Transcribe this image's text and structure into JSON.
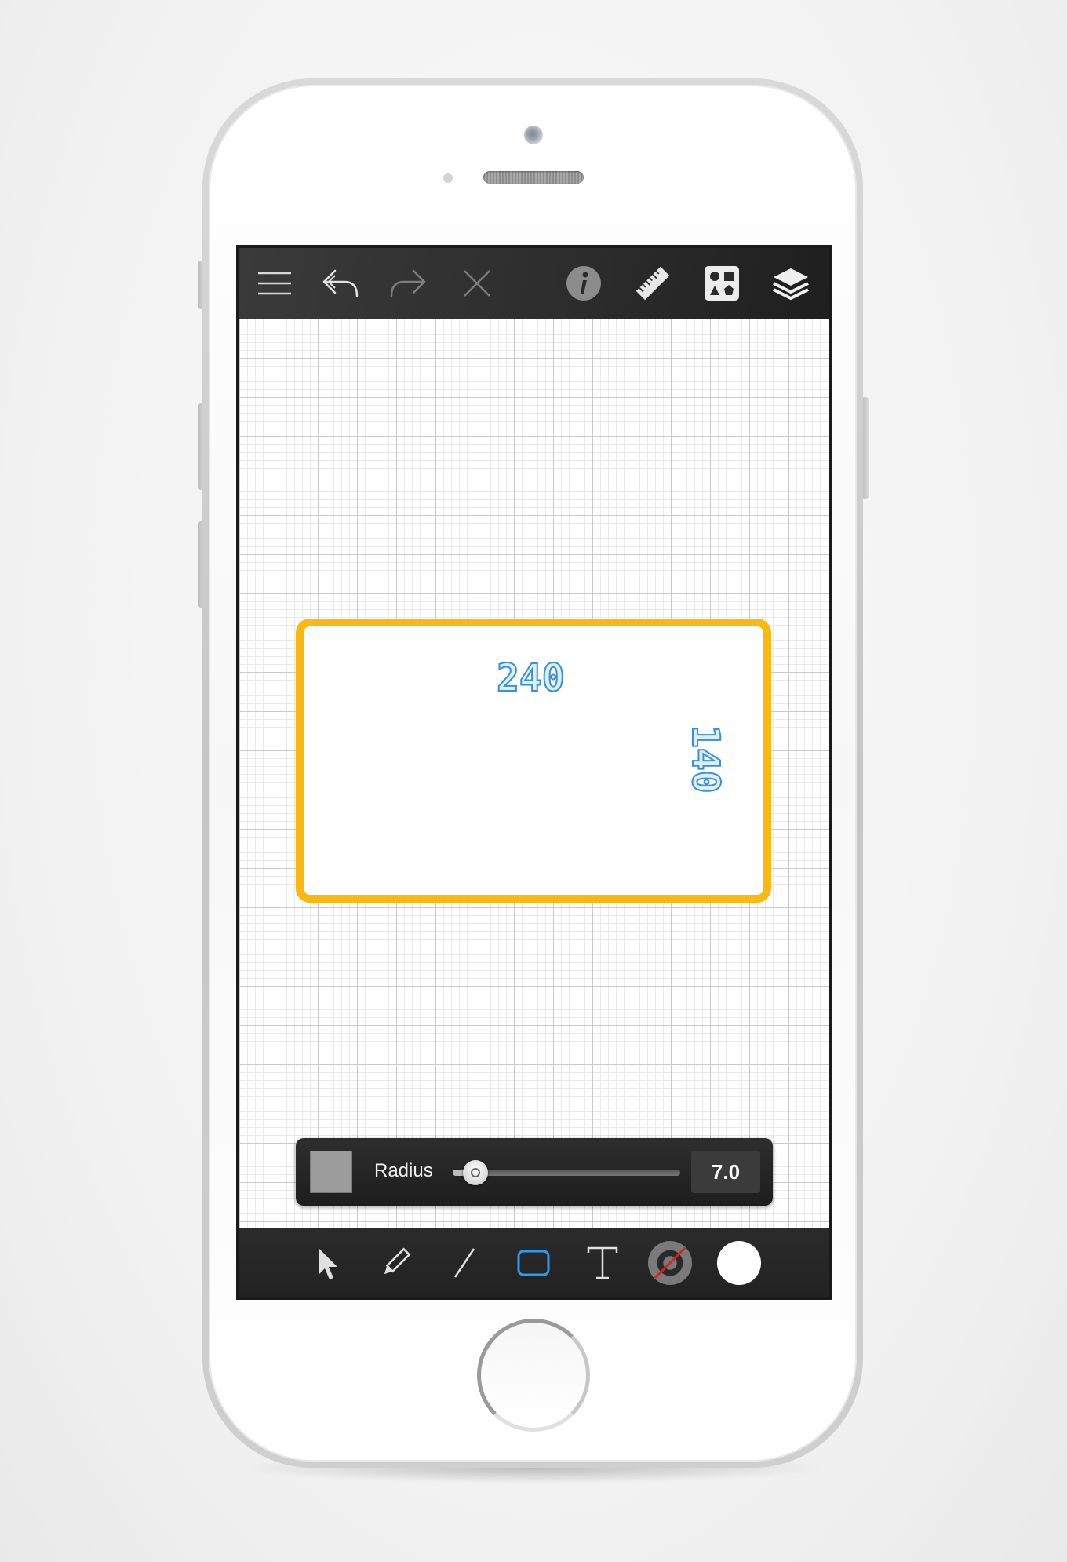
{
  "toolbar_top": {
    "icons": [
      "menu-icon",
      "undo-icon",
      "redo-icon",
      "close-icon",
      "info-icon",
      "ruler-icon",
      "shapes-library-icon",
      "layers-icon"
    ]
  },
  "canvas": {
    "shape": {
      "type": "rounded-rectangle",
      "stroke_color": "#fbb80f",
      "width_label": "240",
      "height_label": "140"
    }
  },
  "radius_panel": {
    "label": "Radius",
    "value": "7.0",
    "slider_fraction": 0.1,
    "swatch_color": "#9c9c9c"
  },
  "toolbar_bottom": {
    "tools": [
      "select-arrow-icon",
      "pencil-icon",
      "line-icon",
      "rectangle-icon",
      "text-icon",
      "stroke-color-icon",
      "fill-color-icon"
    ],
    "active_tool": "rectangle-icon",
    "active_color": "#2d9bf0",
    "fill_color": "#ffffff"
  }
}
